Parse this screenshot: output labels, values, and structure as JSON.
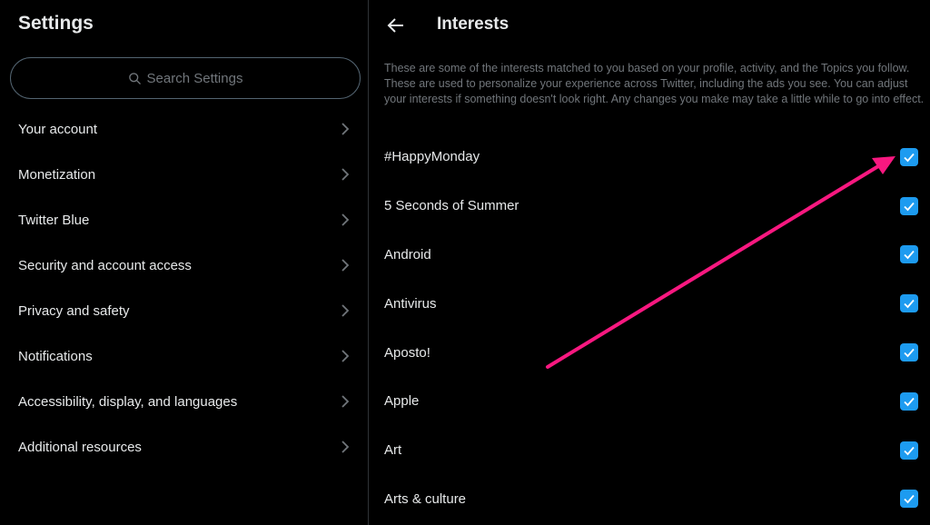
{
  "sidebar": {
    "title": "Settings",
    "search_placeholder": "Search Settings",
    "items": [
      {
        "label": "Your account"
      },
      {
        "label": "Monetization"
      },
      {
        "label": "Twitter Blue"
      },
      {
        "label": "Security and account access"
      },
      {
        "label": "Privacy and safety"
      },
      {
        "label": "Notifications"
      },
      {
        "label": "Accessibility, display, and languages"
      },
      {
        "label": "Additional resources"
      }
    ]
  },
  "main": {
    "title": "Interests",
    "description": "These are some of the interests matched to you based on your profile, activity, and the Topics you follow. These are used to personalize your experience across Twitter, including the ads you see. You can adjust your interests if something doesn't look right. Any changes you make may take a little while to go into effect.",
    "interests": [
      {
        "label": "#HappyMonday",
        "checked": true
      },
      {
        "label": "5 Seconds of Summer",
        "checked": true
      },
      {
        "label": "Android",
        "checked": true
      },
      {
        "label": "Antivirus",
        "checked": true
      },
      {
        "label": "Aposto!",
        "checked": true
      },
      {
        "label": "Apple",
        "checked": true
      },
      {
        "label": "Art",
        "checked": true
      },
      {
        "label": "Arts & culture",
        "checked": true
      }
    ]
  },
  "colors": {
    "accent": "#1d9bf0",
    "annotation_arrow": "#f91880",
    "muted_text": "#71767b"
  }
}
